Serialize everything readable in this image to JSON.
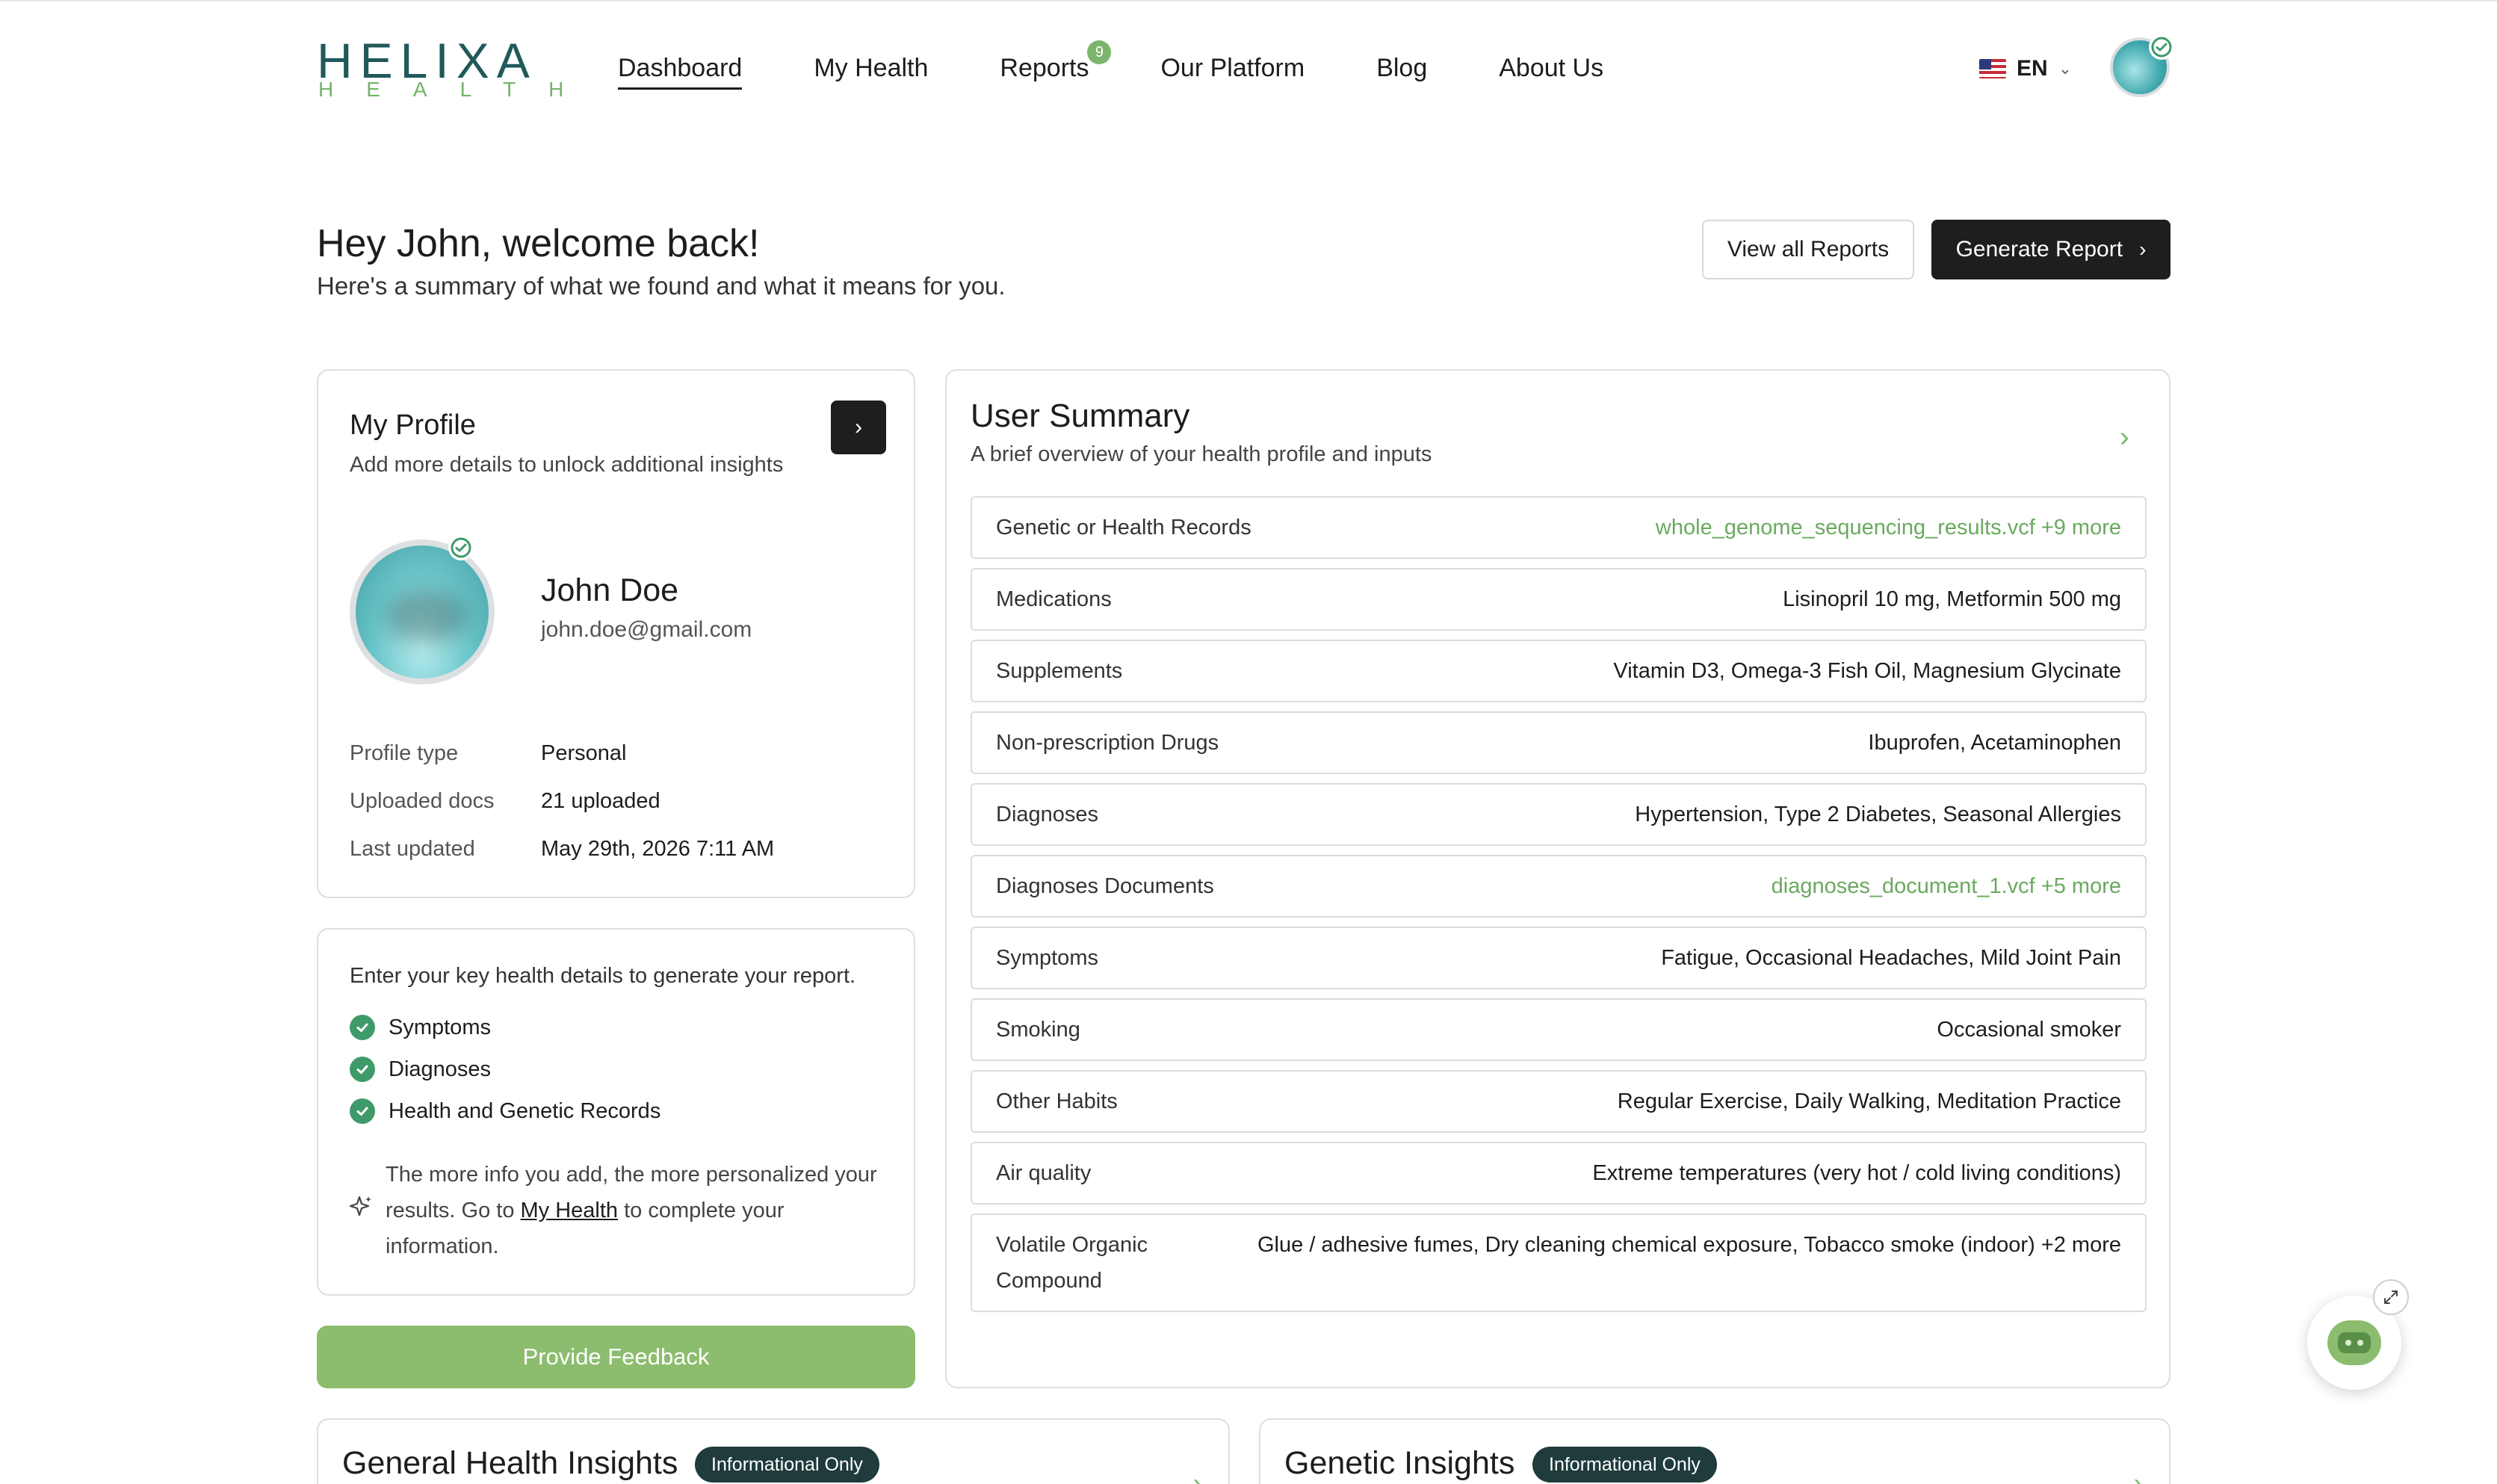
{
  "logo": {
    "main": "HELIXA",
    "sub": "HEALTH"
  },
  "nav": {
    "items": [
      {
        "label": "Dashboard"
      },
      {
        "label": "My Health"
      },
      {
        "label": "Reports",
        "badge": "9"
      },
      {
        "label": "Our Platform"
      },
      {
        "label": "Blog"
      },
      {
        "label": "About Us"
      }
    ],
    "active": "Dashboard"
  },
  "language": {
    "label": "EN",
    "flag": "us-flag-icon"
  },
  "welcome": {
    "title": "Hey John, welcome back!",
    "subtitle": "Here's a summary of what we found and what it means for you."
  },
  "actions": {
    "view_reports": "View all Reports",
    "generate_report": "Generate Report"
  },
  "profile": {
    "title": "My Profile",
    "subtitle": "Add more details to unlock additional insights",
    "name": "John Doe",
    "email": "john.doe@gmail.com",
    "rows": [
      {
        "label": "Profile type",
        "value": "Personal"
      },
      {
        "label": "Uploaded docs",
        "value": "21 uploaded"
      },
      {
        "label": "Last updated",
        "value": "May 29th, 2026 7:11 AM"
      }
    ]
  },
  "details": {
    "intro": "Enter your key health details to generate your report.",
    "items": [
      {
        "label": "Symptoms"
      },
      {
        "label": "Diagnoses"
      },
      {
        "label": "Health and Genetic Records"
      }
    ],
    "note_before": "The more info you add, the more personalized your results. Go to ",
    "note_link": "My Health",
    "note_after": " to complete your information."
  },
  "feedback": {
    "label": "Provide Feedback"
  },
  "summary": {
    "title": "User Summary",
    "subtitle": "A brief overview of your health profile and inputs",
    "rows": [
      {
        "label": "Genetic or Health Records",
        "value": "whole_genome_sequencing_results.vcf +9 more",
        "link": true
      },
      {
        "label": "Medications",
        "value": "Lisinopril 10 mg, Metformin 500 mg"
      },
      {
        "label": "Supplements",
        "value": "Vitamin D3, Omega-3 Fish Oil, Magnesium Glycinate"
      },
      {
        "label": "Non-prescription Drugs",
        "value": "Ibuprofen, Acetaminophen"
      },
      {
        "label": "Diagnoses",
        "value": "Hypertension, Type 2 Diabetes, Seasonal Allergies"
      },
      {
        "label": "Diagnoses Documents",
        "value": "diagnoses_document_1.vcf +5 more",
        "link": true
      },
      {
        "label": "Symptoms",
        "value": "Fatigue, Occasional Headaches, Mild Joint Pain"
      },
      {
        "label": "Smoking",
        "value": "Occasional smoker"
      },
      {
        "label": "Other Habits",
        "value": "Regular Exercise, Daily Walking, Meditation Practice"
      },
      {
        "label": "Air quality",
        "value": "Extreme temperatures (very hot / cold living conditions)"
      },
      {
        "label": "Volatile Organic Compound",
        "value": "Glue / adhesive fumes, Dry cleaning chemical exposure, Tobacco smoke (indoor) +2 more"
      }
    ]
  },
  "insights": [
    {
      "title": "General Health Insights",
      "badge": "Informational Only"
    },
    {
      "title": "Genetic Insights",
      "badge": "Informational Only"
    }
  ],
  "colors": {
    "brand_dark": "#21595a",
    "brand_green": "#7ab56b",
    "button_dark": "#1e1e1e",
    "feedback_green": "#8cbd6e",
    "badge_dark": "#1f3b3c"
  }
}
